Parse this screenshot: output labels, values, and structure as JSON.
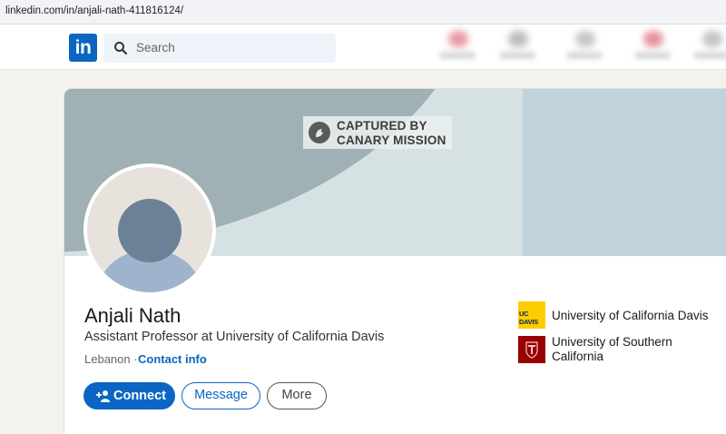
{
  "browser": {
    "url": "linkedin.com/in/anjali-nath-411816124/"
  },
  "nav": {
    "logo": "in",
    "search_placeholder": "Search"
  },
  "banner": {
    "watermark_line1": "CAPTURED BY",
    "watermark_line2": "CANARY MISSION"
  },
  "profile": {
    "name": "Anjali Nath",
    "headline": "Assistant Professor at University of California Davis",
    "location": "Lebanon",
    "separator": "·",
    "contact_info": "Contact info"
  },
  "actions": {
    "connect": "Connect",
    "message": "Message",
    "more": "More"
  },
  "education": [
    {
      "name": "University of California Davis",
      "logo_text": "UC DAVIS"
    },
    {
      "name_line1": "University of Southern",
      "name_line2": "California"
    }
  ],
  "colors": {
    "brand": "#0a66c2",
    "banner_light": "#c0d3db",
    "banner_dark": "#9fb1b4",
    "ucd_gold": "#ffcc00",
    "usc_cardinal": "#990000"
  }
}
